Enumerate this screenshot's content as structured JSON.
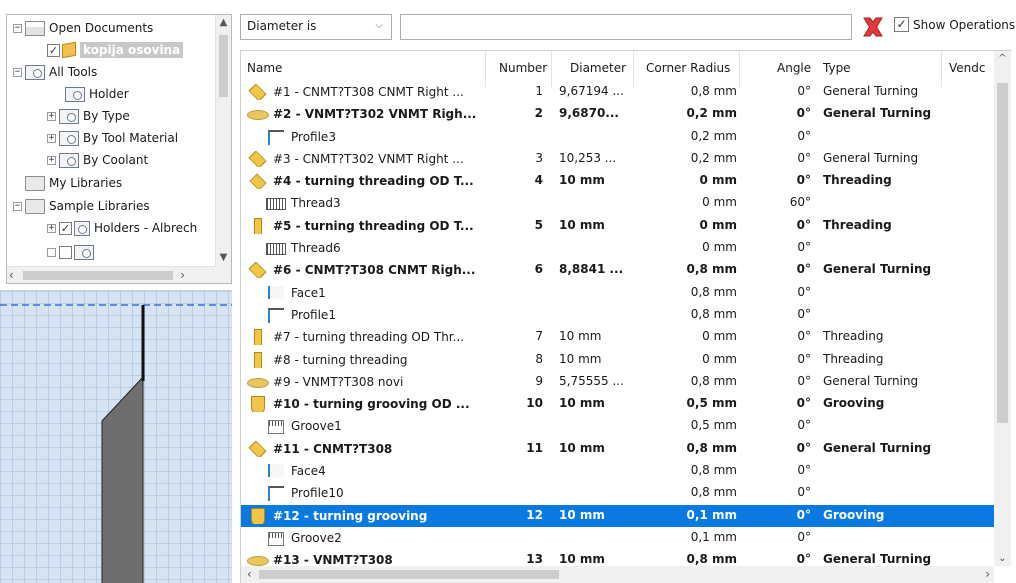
{
  "tree": {
    "items": [
      {
        "label": "Open Documents",
        "expander": "−",
        "icon": "folder-open-icon"
      },
      {
        "label": "kopija osovina",
        "expander": "",
        "icon": "part-cube-icon",
        "checked": "✓"
      },
      {
        "label": "All Tools",
        "expander": "−",
        "icon": "tool-library-icon"
      },
      {
        "label": "Holder",
        "expander": "",
        "icon": "tool-library-icon"
      },
      {
        "label": "By Type",
        "expander": "+",
        "icon": "tool-library-icon"
      },
      {
        "label": "By Tool Material",
        "expander": "+",
        "icon": "tool-library-icon"
      },
      {
        "label": "By Coolant",
        "expander": "+",
        "icon": "tool-library-icon"
      },
      {
        "label": "My Libraries",
        "expander": "",
        "icon": "folder-icon"
      },
      {
        "label": "Sample Libraries",
        "expander": "−",
        "icon": "folder-icon"
      },
      {
        "label": "Holders - Albrech",
        "expander": "+",
        "icon": "holder-icon",
        "checked": "✓"
      }
    ]
  },
  "toolbar": {
    "filter_select": "Diameter is",
    "filter_value": "",
    "show_operations_label": "Show Operations",
    "show_operations_checked": "✓"
  },
  "table": {
    "headers": {
      "name": "Name",
      "number": "Number",
      "diameter": "Diameter",
      "corner_radius": "Corner Radius",
      "angle": "Angle",
      "type": "Type",
      "vendor": "Vendc"
    },
    "rows": [
      {
        "icon": "insert-icon",
        "name": "#1 - CNMT?T308 CNMT Right ...",
        "number": "1",
        "diameter": "9,67194 ...",
        "corner_radius": "0,8 mm",
        "angle": "0°",
        "type": "General Turning",
        "bold": false,
        "sub": false
      },
      {
        "icon": "v-insert-icon",
        "name": "#2 - VNMT?T302 VNMT Righ...",
        "number": "2",
        "diameter": "9,6870...",
        "corner_radius": "0,2 mm",
        "angle": "0°",
        "type": "General Turning",
        "bold": true,
        "sub": false
      },
      {
        "icon": "profile-op-icon",
        "name": "Profile3",
        "number": "",
        "diameter": "",
        "corner_radius": "0,2 mm",
        "angle": "0°",
        "type": "",
        "bold": false,
        "sub": true
      },
      {
        "icon": "insert-icon",
        "name": "#3 - CNMT?T302 VNMT Right ...",
        "number": "3",
        "diameter": "10,253 ...",
        "corner_radius": "0,2 mm",
        "angle": "0°",
        "type": "General Turning",
        "bold": false,
        "sub": false
      },
      {
        "icon": "thread-insert-wide-icon",
        "name": "#4 - turning threading OD T...",
        "number": "4",
        "diameter": "10 mm",
        "corner_radius": "0 mm",
        "angle": "0°",
        "type": "Threading",
        "bold": true,
        "sub": false
      },
      {
        "icon": "thread-op-icon",
        "name": "Thread3",
        "number": "",
        "diameter": "",
        "corner_radius": "0 mm",
        "angle": "60°",
        "type": "",
        "bold": false,
        "sub": true
      },
      {
        "icon": "thread-insert-icon",
        "name": "#5 - turning threading OD T...",
        "number": "5",
        "diameter": "10 mm",
        "corner_radius": "0 mm",
        "angle": "0°",
        "type": "Threading",
        "bold": true,
        "sub": false
      },
      {
        "icon": "thread-op-icon",
        "name": "Thread6",
        "number": "",
        "diameter": "",
        "corner_radius": "0 mm",
        "angle": "0°",
        "type": "",
        "bold": false,
        "sub": true
      },
      {
        "icon": "insert-icon",
        "name": "#6 - CNMT?T308 CNMT Righ...",
        "number": "6",
        "diameter": "8,8841 ...",
        "corner_radius": "0,8 mm",
        "angle": "0°",
        "type": "General Turning",
        "bold": true,
        "sub": false
      },
      {
        "icon": "face-op-icon",
        "name": "Face1",
        "number": "",
        "diameter": "",
        "corner_radius": "0,8 mm",
        "angle": "0°",
        "type": "",
        "bold": false,
        "sub": true
      },
      {
        "icon": "profile-op-icon",
        "name": "Profile1",
        "number": "",
        "diameter": "",
        "corner_radius": "0,8 mm",
        "angle": "0°",
        "type": "",
        "bold": false,
        "sub": true
      },
      {
        "icon": "thread-insert-icon",
        "name": "#7 - turning threading OD Thr...",
        "number": "7",
        "diameter": "10 mm",
        "corner_radius": "0 mm",
        "angle": "0°",
        "type": "Threading",
        "bold": false,
        "sub": false
      },
      {
        "icon": "thread-insert-icon",
        "name": "#8 - turning threading",
        "number": "8",
        "diameter": "10 mm",
        "corner_radius": "0 mm",
        "angle": "0°",
        "type": "Threading",
        "bold": false,
        "sub": false
      },
      {
        "icon": "v-insert-icon",
        "name": "#9 - VNMT?T308 novi",
        "number": "9",
        "diameter": "5,75555 ...",
        "corner_radius": "0,8 mm",
        "angle": "0°",
        "type": "General Turning",
        "bold": false,
        "sub": false
      },
      {
        "icon": "grooving-insert-icon",
        "name": "#10 - turning grooving OD ...",
        "number": "10",
        "diameter": "10 mm",
        "corner_radius": "0,5 mm",
        "angle": "0°",
        "type": "Grooving",
        "bold": true,
        "sub": false
      },
      {
        "icon": "groove-op-icon",
        "name": "Groove1",
        "number": "",
        "diameter": "",
        "corner_radius": "0,5 mm",
        "angle": "0°",
        "type": "",
        "bold": false,
        "sub": true
      },
      {
        "icon": "insert-icon",
        "name": "#11 - CNMT?T308",
        "number": "11",
        "diameter": "10 mm",
        "corner_radius": "0,8 mm",
        "angle": "0°",
        "type": "General Turning",
        "bold": true,
        "sub": false
      },
      {
        "icon": "face-op-icon",
        "name": "Face4",
        "number": "",
        "diameter": "",
        "corner_radius": "0,8 mm",
        "angle": "0°",
        "type": "",
        "bold": false,
        "sub": true
      },
      {
        "icon": "profile-op-icon",
        "name": "Profile10",
        "number": "",
        "diameter": "",
        "corner_radius": "0,8 mm",
        "angle": "0°",
        "type": "",
        "bold": false,
        "sub": true
      },
      {
        "icon": "grooving-insert-icon",
        "name": "#12 - turning grooving",
        "number": "12",
        "diameter": "10 mm",
        "corner_radius": "0,1 mm",
        "angle": "0°",
        "type": "Grooving",
        "bold": true,
        "sub": false,
        "selected": true
      },
      {
        "icon": "groove-op-icon",
        "name": "Groove2",
        "number": "",
        "diameter": "",
        "corner_radius": "0,1 mm",
        "angle": "0°",
        "type": "",
        "bold": false,
        "sub": true
      },
      {
        "icon": "v-insert-icon",
        "name": "#13 - VNMT?T308",
        "number": "13",
        "diameter": "10 mm",
        "corner_radius": "0,8 mm",
        "angle": "0°",
        "type": "General Turning",
        "bold": true,
        "sub": false
      }
    ]
  },
  "colors": {
    "selection": "#0a7ae0",
    "clear_button": "#e03a3a",
    "preview_bg": "#d6e3f2",
    "preview_grid_dash": "#3a6fd8",
    "tool_body": "#6e6e6e"
  }
}
